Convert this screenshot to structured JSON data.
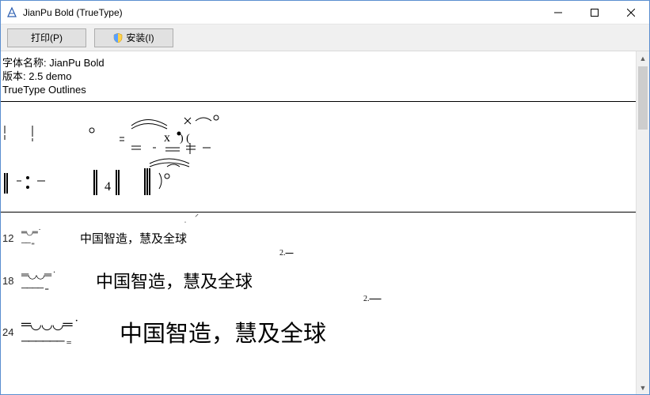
{
  "window": {
    "title": "JianPu Bold (TrueType)"
  },
  "toolbar": {
    "print_label": "打印(P)",
    "install_label": "安装(I)"
  },
  "meta": {
    "name_label": "字体名称:",
    "name_value": "JianPu Bold",
    "version_label": "版本:",
    "version_value": "2.5 demo",
    "outlines": "TrueType Outlines"
  },
  "samples": {
    "text_cn": "中国智造，慧及全球",
    "sizes": [
      {
        "pt": "12"
      },
      {
        "pt": "18"
      },
      {
        "pt": "24"
      }
    ],
    "mark": "2."
  }
}
